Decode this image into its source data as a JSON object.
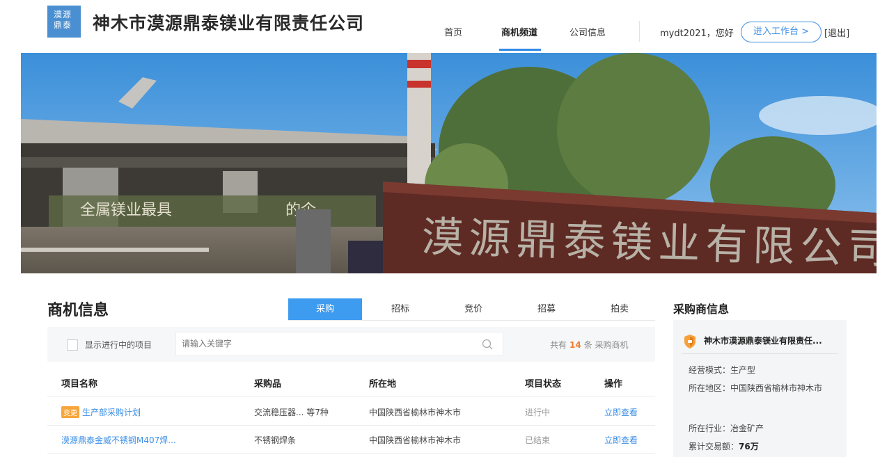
{
  "header": {
    "logo_line1": "漠源",
    "logo_line2": "鼎泰",
    "company_title": "神木市漠源鼎泰镁业有限责任公司",
    "nav": {
      "home": "首页",
      "biz_channel": "商机频道",
      "company_info": "公司信息"
    },
    "user_greeting": "mydt2021，您好",
    "workbench_button": "进入工作台 >",
    "logout": "[退出]"
  },
  "banner": {
    "sign_text": "漠源鼎泰镁业有限公司",
    "slogan_text": "全属镁业最具",
    "slogan_text2": "的企"
  },
  "biz_section": {
    "title": "商机信息",
    "tabs": [
      {
        "label": "采购",
        "active": true
      },
      {
        "label": "招标",
        "active": false
      },
      {
        "label": "竞价",
        "active": false
      },
      {
        "label": "招募",
        "active": false
      },
      {
        "label": "拍卖",
        "active": false
      }
    ],
    "filter": {
      "show_ongoing_label": "显示进行中的项目",
      "search_placeholder": "请输入关键字",
      "count_prefix": "共有",
      "count_value": "14",
      "count_suffix": "条 采购商机"
    },
    "table": {
      "headers": [
        "项目名称",
        "采购品",
        "所在地",
        "项目状态",
        "操作"
      ],
      "rows": [
        {
          "tag": "变更",
          "name": "生产部采购计划",
          "item": "交流稳压器... 等7种",
          "location": "中国陕西省榆林市神木市",
          "status": "进行中",
          "action": "立即查看"
        },
        {
          "tag": "",
          "name": "漠源鼎泰金威不锈钢M407焊...",
          "item": "不锈钢焊条",
          "location": "中国陕西省榆林市神木市",
          "status": "已结束",
          "action": "立即查看"
        }
      ]
    }
  },
  "buyer": {
    "title": "采购商信息",
    "company": "神木市漠源鼎泰镁业有限责任...",
    "mode_label": "经营模式：",
    "mode_value": "生产型",
    "region_label": "所在地区：",
    "region_value": "中国陕西省榆林市神木市",
    "industry_label": "所在行业：",
    "industry_value": "冶金矿产",
    "volume_label": "累计交易额：",
    "volume_value": "76万"
  },
  "colors": {
    "accent": "#3a8ee6",
    "tab_active": "#3d9bf0",
    "count_highlight": "#f07b2e",
    "tag": "#f8a53a"
  }
}
